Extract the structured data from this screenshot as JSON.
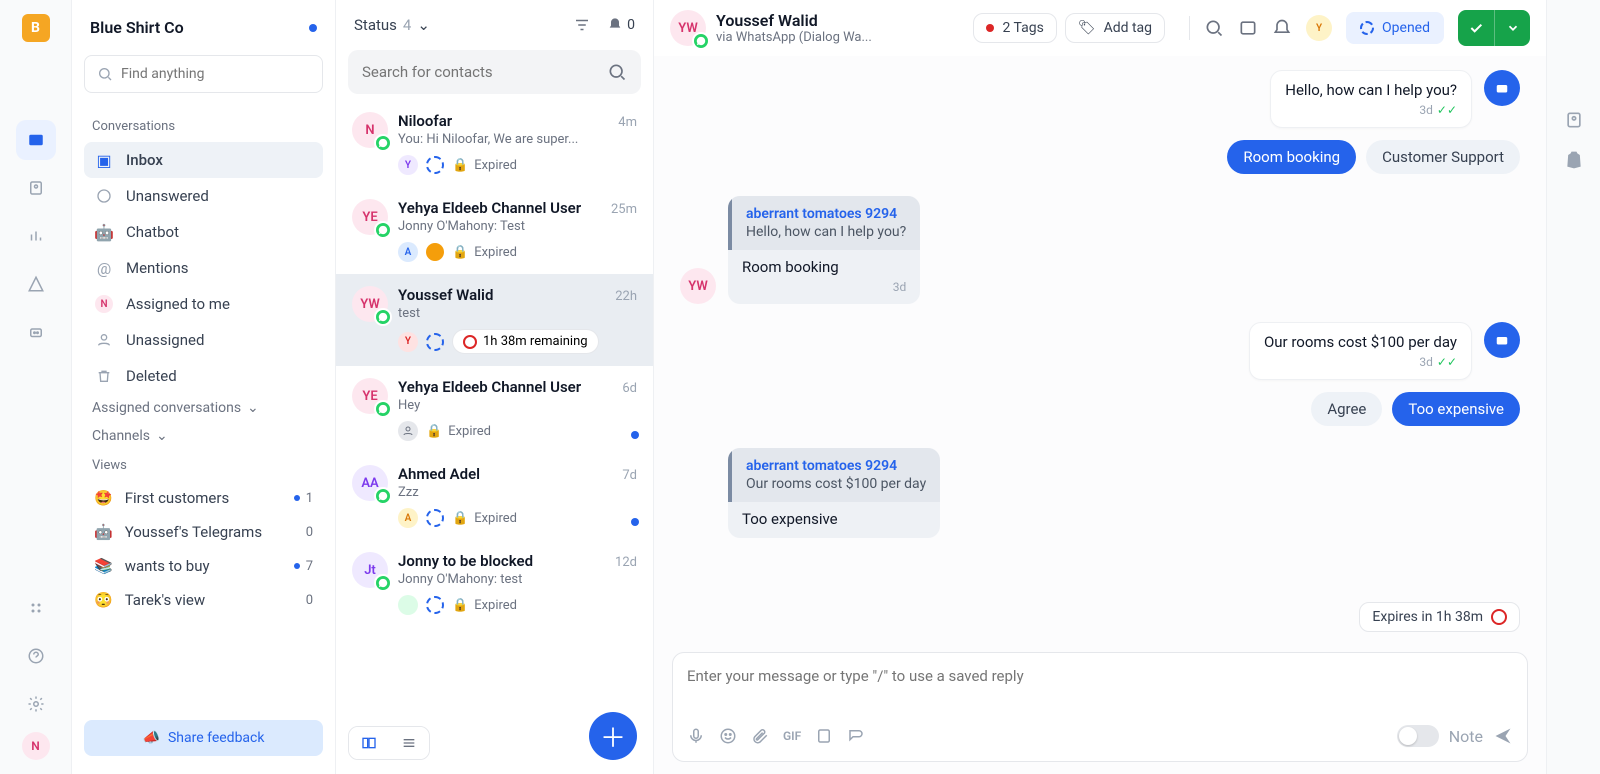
{
  "rail": {
    "logo": "B",
    "avatar": "N"
  },
  "workspace": {
    "name": "Blue Shirt Co"
  },
  "find_placeholder": "Find anything",
  "conversations_label": "Conversations",
  "nav": [
    {
      "label": "Inbox",
      "active": true,
      "icon": "inbox"
    },
    {
      "label": "Unanswered",
      "icon": "circle"
    },
    {
      "label": "Chatbot",
      "icon": "bot"
    },
    {
      "label": "Mentions",
      "icon": "at"
    },
    {
      "label": "Assigned to me",
      "icon": "avatar-n"
    },
    {
      "label": "Unassigned",
      "icon": "user-x"
    },
    {
      "label": "Deleted",
      "icon": "trash"
    }
  ],
  "assigned_label": "Assigned conversations",
  "channels_label": "Channels",
  "views_label": "Views",
  "views": [
    {
      "emoji": "🤩",
      "label": "First customers",
      "count": "1",
      "dotted": true
    },
    {
      "emoji": "🤖",
      "label": "Youssef's Telegrams",
      "count": "0"
    },
    {
      "emoji": "📚",
      "label": "wants to buy",
      "count": "7",
      "dotted": true
    },
    {
      "emoji": "😳",
      "label": "Tarek's view",
      "count": "0"
    }
  ],
  "feedback": "Share feedback",
  "list": {
    "status_label": "Status",
    "status_count": "4",
    "bell_count": "0",
    "search_placeholder": "Search for contacts",
    "expired": "Expired",
    "items": [
      {
        "name": "Niloofar",
        "initials": "N",
        "avbg": "#fde7ef",
        "avfg": "#d6336c",
        "time": "4m",
        "preview": "You:  Hi Niloofar, We are super...",
        "mini": "Y",
        "minibg": "#efe9ff",
        "minifg": "#7c3aed",
        "dashColor": "#2563eb",
        "status": "expired"
      },
      {
        "name": "Yehya Eldeeb Channel User",
        "initials": "YE",
        "avbg": "#fde7ef",
        "avfg": "#d6336c",
        "time": "25m",
        "preview": "Jonny O'Mahony:  Test",
        "mini": "A",
        "minibg": "#dbeafe",
        "minifg": "#2563eb",
        "dashColor": "#2563eb",
        "dotFilled": "#f59e0b",
        "status": "expired"
      },
      {
        "name": "Youssef Walid",
        "initials": "YW",
        "avbg": "#fde7ef",
        "avfg": "#d6336c",
        "time": "22h",
        "preview": "test",
        "mini": "Y",
        "minibg": "#fee2e2",
        "minifg": "#dc2626",
        "dashColor": "#2563eb",
        "remaining": "1h 38m remaining",
        "selected": true
      },
      {
        "name": "Yehya Eldeeb Channel User",
        "initials": "YE",
        "avbg": "#fde7ef",
        "avfg": "#d6336c",
        "time": "6d",
        "preview": "Hey",
        "miniGray": true,
        "status": "expired",
        "unread": true
      },
      {
        "name": "Ahmed Adel",
        "initials": "AA",
        "avbg": "#efe9ff",
        "avfg": "#7c3aed",
        "time": "7d",
        "preview": "Zzz",
        "mini": "A",
        "minibg": "#fef3c7",
        "minifg": "#d97706",
        "dashColor": "#2563eb",
        "status": "expired",
        "unread": true
      },
      {
        "name": "Jonny to be blocked",
        "initials": "Jt",
        "avbg": "#efe9ff",
        "avfg": "#7c3aed",
        "time": "12d",
        "preview": "Jonny O'Mahony:  test",
        "mini": "",
        "minibg": "#dcfce7",
        "minifg": "#16a34a",
        "dashColor": "#2563eb",
        "status": "expired"
      }
    ]
  },
  "chat": {
    "contact": {
      "name": "Youssef Walid",
      "initials": "YW",
      "via": "via WhatsApp (Dialog Wa..."
    },
    "tags_count": "2 Tags",
    "add_tag": "Add tag",
    "status": "Opened",
    "head_avatar": "Y",
    "messages": {
      "m1": {
        "text": "Hello, how can I help you?",
        "time": "3d"
      },
      "chips1": {
        "a": "Room booking",
        "b": "Customer Support"
      },
      "m2": {
        "quote_name": "aberrant tomatoes 9294",
        "quote_text": "Hello, how can I help you?",
        "body": "Room booking",
        "time": "3d",
        "avatar": "YW"
      },
      "m3": {
        "text": "Our rooms cost $100 per day",
        "time": "3d"
      },
      "chips2": {
        "a": "Agree",
        "b": "Too expensive"
      },
      "m4": {
        "quote_name": "aberrant tomatoes 9294",
        "quote_text": "Our rooms cost $100 per day",
        "body": "Too expensive"
      }
    },
    "expires": "Expires in 1h 38m",
    "composer_placeholder": "Enter your message or type \"/\" to use a saved reply",
    "note": "Note"
  }
}
